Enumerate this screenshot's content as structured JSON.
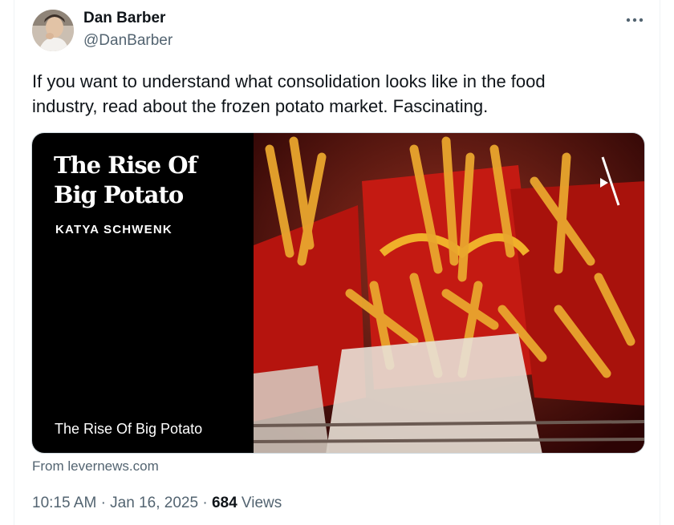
{
  "author": {
    "name": "Dan Barber",
    "handle": "@DanBarber",
    "avatar_icon": "person-portrait"
  },
  "more_icon": "ellipsis-horizontal-icon",
  "tweet": {
    "line1": "If you want to understand what consolidation looks like in the food",
    "line2": "industry, read about the frozen potato market. Fascinating."
  },
  "card": {
    "title_line1": "The Rise Of",
    "title_line2": "Big Potato",
    "author": "KATYA SCHWENK",
    "caption": "The Rise Of Big Potato",
    "image_subject": "french fries in red cartons",
    "source": "From levernews.com",
    "colors": {
      "panel": "#000000",
      "fries": "#e9a62e",
      "carton": "#c0201a"
    }
  },
  "meta": {
    "time": "10:15 AM",
    "separator": "·",
    "date": "Jan 16, 2025",
    "views_count": "684",
    "views_label": "Views"
  }
}
